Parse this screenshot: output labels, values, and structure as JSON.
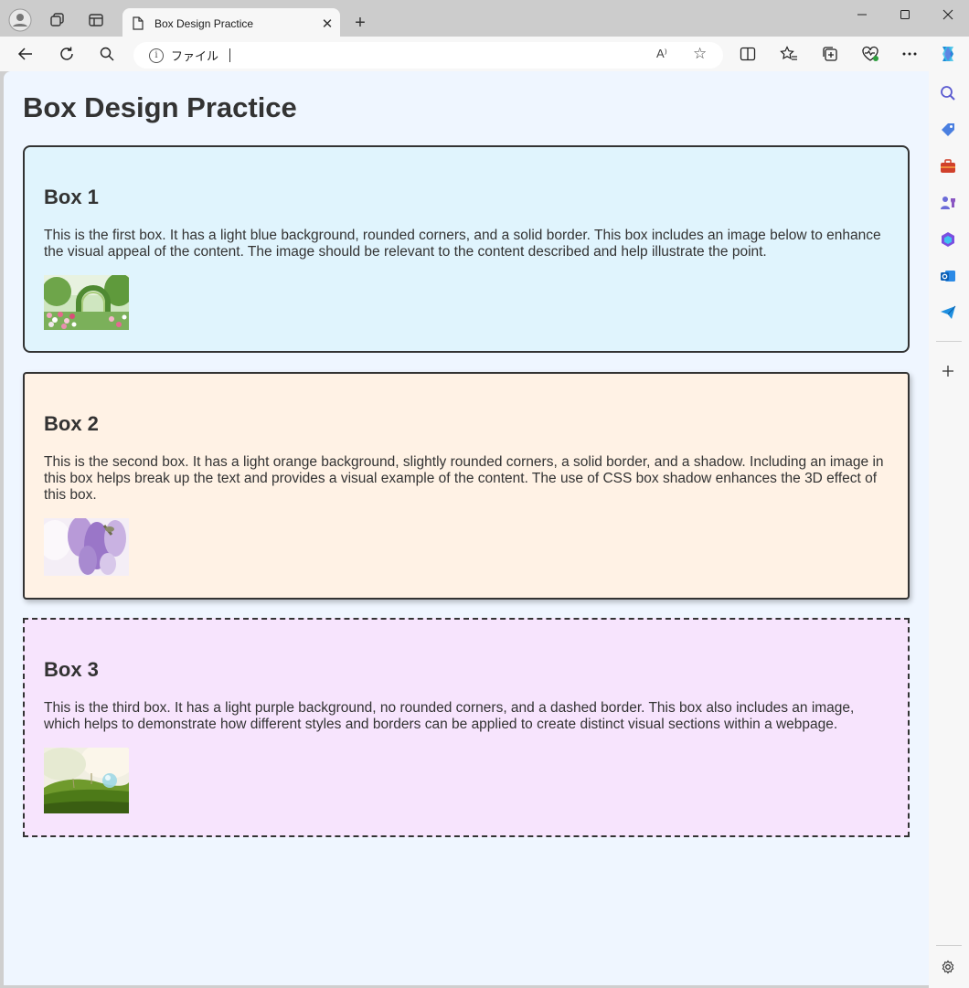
{
  "browser": {
    "tab_title": "Box Design Practice",
    "address_text": "ファイル",
    "read_aloud_label": "A⁾"
  },
  "page": {
    "heading": "Box Design Practice",
    "boxes": [
      {
        "title": "Box 1",
        "text": "This is the first box. It has a light blue background, rounded corners, and a solid border. This box includes an image below to enhance the visual appeal of the content. The image should be relevant to the content described and help illustrate the point.",
        "image": "garden-arch-photo"
      },
      {
        "title": "Box 2",
        "text": "This is the second box. It has a light orange background, slightly rounded corners, a solid border, and a shadow. Including an image in this box helps break up the text and provides a visual example of the content. The use of CSS box shadow enhances the 3D effect of this box.",
        "image": "wisteria-photo"
      },
      {
        "title": "Box 3",
        "text": "This is the third box. It has a light purple background, no rounded corners, and a dashed border. This box also includes an image, which helps to demonstrate how different styles and borders can be applied to create distinct visual sections within a webpage.",
        "image": "moss-droplet-photo"
      }
    ]
  },
  "colors": {
    "box1_bg": "#e0f4fd",
    "box2_bg": "#fff2e5",
    "box3_bg": "#f7e4fd",
    "page_bg": "#eff6ff",
    "text": "#333333"
  }
}
